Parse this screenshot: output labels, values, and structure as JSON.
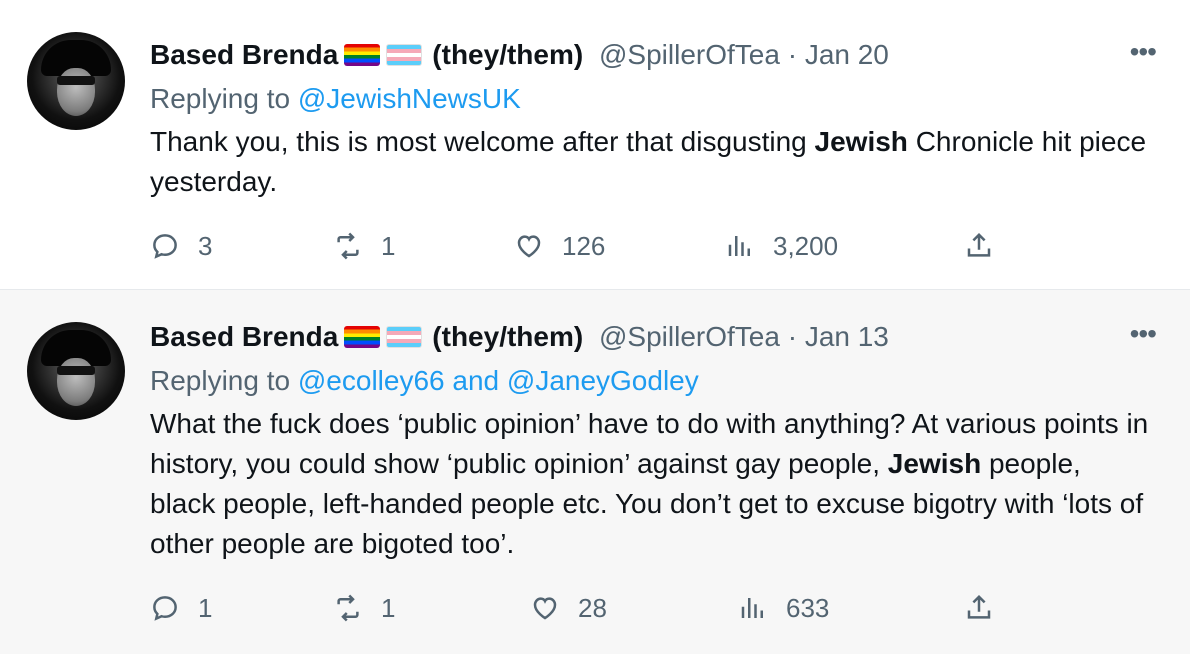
{
  "tweets": [
    {
      "name": "Based Brenda",
      "pronouns": "(they/them)",
      "handle": "@SpillerOfTea",
      "separator": "·",
      "date": "Jan 20",
      "replying_prefix": "Replying to",
      "replying_to": "@JewishNewsUK",
      "text_parts": {
        "a": "Thank you, this is most welcome after that disgusting ",
        "b": "Jewish",
        "c": " Chronicle hit piece yesterday."
      },
      "stats": {
        "replies": "3",
        "retweets": "1",
        "likes": "126",
        "views": "3,200"
      }
    },
    {
      "name": "Based Brenda",
      "pronouns": "(they/them)",
      "handle": "@SpillerOfTea",
      "separator": "·",
      "date": "Jan 13",
      "replying_prefix": "Replying to",
      "replying_to": "@ecolley66",
      "replying_and": "and",
      "replying_to_2": "@JaneyGodley",
      "text_parts": {
        "a": "What the fuck does ‘public opinion’ have to do with anything? At various points in history, you could show ‘public opinion’ against gay people, ",
        "b": "Jewish",
        "c": " people, black people, left-handed people etc. You don’t get to excuse bigotry with ‘lots of other people are bigoted too’."
      },
      "stats": {
        "replies": "1",
        "retweets": "1",
        "likes": "28",
        "views": "633"
      }
    }
  ],
  "icons": {
    "more": "more-icon",
    "reply": "reply-icon",
    "retweet": "retweet-icon",
    "like": "like-icon",
    "views": "views-icon",
    "share": "share-icon"
  },
  "colors": {
    "link": "#1d9bf0",
    "secondary": "#536471",
    "text": "#0f1419"
  }
}
